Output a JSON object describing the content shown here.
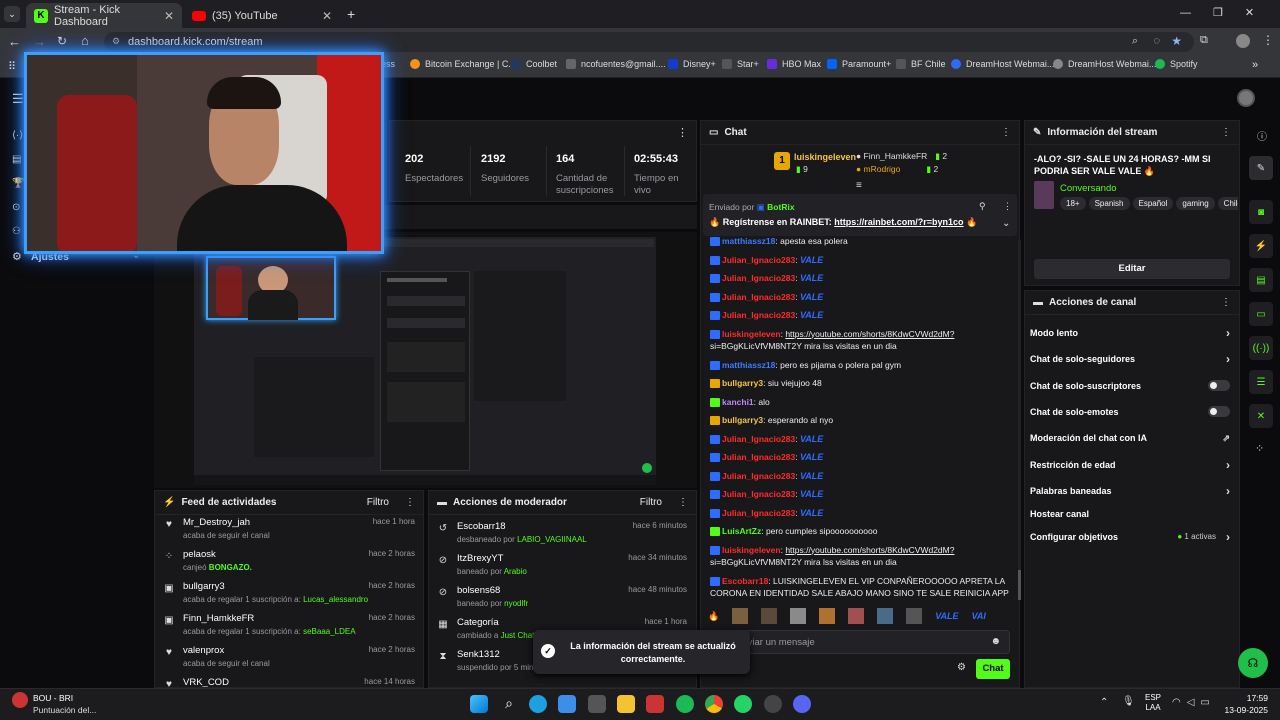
{
  "browser": {
    "tabs": [
      {
        "title": "Stream - Kick Dashboard",
        "active": true
      },
      {
        "title": "(35) YouTube",
        "active": false
      }
    ],
    "url": "dashboard.kick.com/stream",
    "bookmarks": [
      "ress",
      "Bitcoin Exchange | C...",
      "Coolbet",
      "ncofuentes@gmail....",
      "Disney+",
      "Star+",
      "HBO Max",
      "Paramount+",
      "BF Chile",
      "DreamHost Webmai...",
      "DreamHost Webmai...",
      "Spotify"
    ]
  },
  "nav": {
    "settings_label": "Ajustes"
  },
  "stats": [
    {
      "value": "202",
      "label": "Espectadores"
    },
    {
      "value": "2192",
      "label": "Seguidores"
    },
    {
      "value": "164",
      "label": "Cantidad de suscripciones"
    },
    {
      "value": "02:55:43",
      "label": "Tiempo en vivo"
    }
  ],
  "feed": {
    "title": "Feed de actividades",
    "filter": "Filtro",
    "items": [
      {
        "name": "Mr_Destroy_jah",
        "pre": "acaba de seguir el canal",
        "hl": "",
        "post": "",
        "time": "hace 1 hora",
        "icon": "heart"
      },
      {
        "name": "pelaosk",
        "pre": "canjeó ",
        "hl": "BONGAZO.",
        "post": "",
        "time": "hace 2 horas",
        "icon": "dots"
      },
      {
        "name": "bullgarry3",
        "pre": "acaba de regalar 1 suscripción a: ",
        "hl": "Lucas_alessandro",
        "post": "",
        "time": "hace 2 horas",
        "icon": "gift"
      },
      {
        "name": "Finn_HamkkeFR",
        "pre": "acaba de regalar 1 suscripción a: ",
        "hl": "seBaaa_LDEA",
        "post": "",
        "time": "hace 2 horas",
        "icon": "gift"
      },
      {
        "name": "valenprox",
        "pre": "acaba de seguir el canal",
        "hl": "",
        "post": "",
        "time": "hace 2 horas",
        "icon": "heart"
      },
      {
        "name": "VRK_COD",
        "pre": "",
        "hl": "",
        "post": "",
        "time": "hace 14 horas",
        "icon": "heart"
      }
    ]
  },
  "mod": {
    "title": "Acciones de moderador",
    "filter": "Filtro",
    "items": [
      {
        "name": "Escobarr18",
        "pre": "desbaneado por ",
        "hl": "LABIO_VAGIINAAL",
        "time": "hace 6 minutos",
        "icon": "undo"
      },
      {
        "name": "ItzBrexyYT",
        "pre": "baneado por ",
        "hl": "Arabio",
        "time": "hace 34 minutos",
        "icon": "ban"
      },
      {
        "name": "bolsens68",
        "pre": "baneado por ",
        "hl": "nyodlfr",
        "time": "hace 48 minutos",
        "icon": "ban"
      },
      {
        "name": "Categoría",
        "pre": "cambiado a ",
        "hl": "Just Chatt",
        "time": "hace 1 hora",
        "icon": "calendar"
      },
      {
        "name": "Senk1312",
        "pre": "suspendido por 5 min",
        "hl": "",
        "time": "",
        "icon": "hourglass"
      }
    ]
  },
  "toast": {
    "line1": "La información del stream se actualizó",
    "line2": "correctamente."
  },
  "chat": {
    "title": "Chat",
    "leader": {
      "rank": "1",
      "name": "luiskingeleven",
      "count": "9"
    },
    "others": [
      {
        "name": "Finn_HamkkeFR",
        "count": "2"
      },
      {
        "name": "mRodrigo",
        "count": "2"
      }
    ],
    "pinned": {
      "by_label": "Enviado por",
      "by": "BotRix",
      "text": "Regístrense en RAINBET: ",
      "link": "https://rainbet.com/?r=byn1co"
    },
    "messages": [
      {
        "user": "matthiassz18",
        "color": "#3d7bff",
        "text": "apesta esa polera",
        "vale": false
      },
      {
        "user": "Julian_Ignacio283",
        "color": "#ff2b2b",
        "text": "",
        "vale": true
      },
      {
        "user": "Julian_Ignacio283",
        "color": "#ff2b2b",
        "text": "",
        "vale": true
      },
      {
        "user": "Julian_Ignacio283",
        "color": "#ff2b2b",
        "text": "",
        "vale": true
      },
      {
        "user": "Julian_Ignacio283",
        "color": "#ff2b2b",
        "text": "",
        "vale": true
      },
      {
        "user": "luiskingeleven",
        "color": "#ff2b2b",
        "text": "https://youtube.com/shorts/8KdwCVWd2dM?",
        "cont": "si=BGgKLicVfVM8NT2Y mira lss visitas en un dia",
        "vale": false
      },
      {
        "user": "matthiassz18",
        "color": "#3d7bff",
        "text": "pero es pijama o polera pal gym",
        "vale": false
      },
      {
        "user": "bullgarry3",
        "color": "#f5c542",
        "text": "siu viejujoo 48",
        "vale": false
      },
      {
        "user": "kanchi1",
        "color": "#c084fc",
        "text": "alo",
        "vale": false
      },
      {
        "user": "bullgarry3",
        "color": "#f5c542",
        "text": "esperando al nyo",
        "vale": false
      },
      {
        "user": "Julian_Ignacio283",
        "color": "#ff2b2b",
        "text": "",
        "vale": true
      },
      {
        "user": "Julian_Ignacio283",
        "color": "#ff2b2b",
        "text": "",
        "vale": true
      },
      {
        "user": "Julian_Ignacio283",
        "color": "#ff2b2b",
        "text": "",
        "vale": true
      },
      {
        "user": "Julian_Ignacio283",
        "color": "#ff2b2b",
        "text": "",
        "vale": true
      },
      {
        "user": "Julian_Ignacio283",
        "color": "#ff2b2b",
        "text": "",
        "vale": true
      },
      {
        "user": "LuisArtZz",
        "color": "#53fc18",
        "text": "pero cumples sipoooooooooo",
        "vale": false
      },
      {
        "user": "luiskingeleven",
        "color": "#ff2b2b",
        "text": "https://youtube.com/shorts/8KdwCVWd2dM?",
        "cont": "si=BGgKLicVfVM8NT2Y mira lss visitas en un dia",
        "vale": false
      },
      {
        "user": "Escobarr18",
        "color": "#ff2b2b",
        "text": "LUISKINGELEVEN EL VIP CONPAÑEROOOOO APRETA LA",
        "cont": "CORONA EN IDENTIDAD SALE ABAJO MANO SINO TE SALE REINICIA APP",
        "vale": false
      }
    ],
    "vale_label": "VALE",
    "input_placeholder": "Enviar un mensaje",
    "send_label": "Chat"
  },
  "stream_info": {
    "title": "Información del stream",
    "stream_title": "-ALO? -SI? -SALE UN 24 HORAS? -MM SI PODRIA SER VALE VALE",
    "category": "Conversando",
    "tags": [
      "18+",
      "Spanish",
      "Español",
      "gaming",
      "Chile"
    ],
    "edit_label": "Editar"
  },
  "channel_actions": {
    "title": "Acciones de canal",
    "items": [
      {
        "label": "Modo lento",
        "kind": "chevron"
      },
      {
        "label": "Chat de solo-seguidores",
        "kind": "chevron"
      },
      {
        "label": "Chat de solo-suscriptores",
        "kind": "toggle"
      },
      {
        "label": "Chat de solo-emotes",
        "kind": "toggle"
      },
      {
        "label": "Moderación del chat con IA",
        "kind": "external"
      },
      {
        "label": "Restricción de edad",
        "kind": "chevron"
      },
      {
        "label": "Palabras baneadas",
        "kind": "chevron"
      },
      {
        "label": "Hostear canal",
        "kind": "none"
      },
      {
        "label": "Configurar objetivos",
        "kind": "chevron",
        "extra": "1 activas"
      }
    ]
  },
  "taskbar": {
    "weather_title": "BOU - BRI",
    "weather_sub": "Puntuación del...",
    "lang": "ESP",
    "lang2": "LAA",
    "time": "17:59",
    "date": "13-09-2025"
  },
  "colors": {
    "kick_green": "#53fc18",
    "panel": "#18181b"
  }
}
